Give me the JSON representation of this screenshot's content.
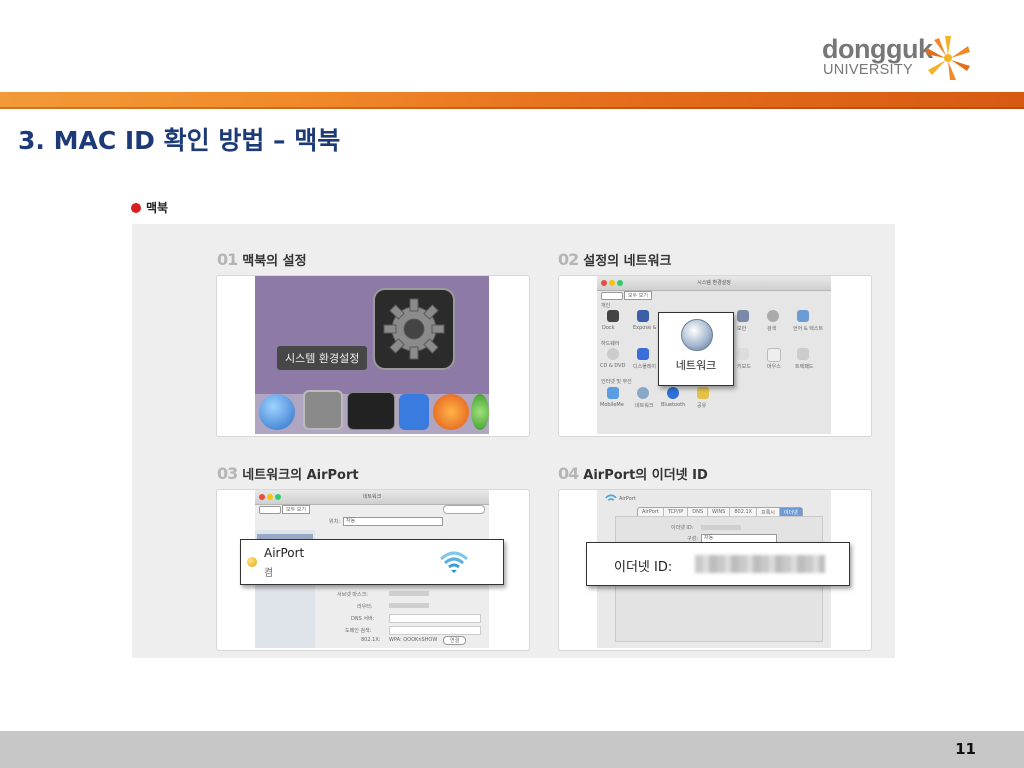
{
  "logo": {
    "line1": "dongguk",
    "line2": "UNIVERSITY"
  },
  "title": "3. MAC ID 확인 방법 – 맥북",
  "section_badge": "맥북",
  "steps": [
    {
      "num": "01",
      "label": "맥북의 설정"
    },
    {
      "num": "02",
      "label": "설정의 네트워크"
    },
    {
      "num": "03",
      "label": "네트워크의 AirPort"
    },
    {
      "num": "04",
      "label": "AirPort의 이더넷 ID"
    }
  ],
  "shot1": {
    "callout": "시스템 환경설정"
  },
  "shot2": {
    "window_title": "시스템 환경설정",
    "show_all": "모두 보기",
    "row1_label": "개인",
    "row2_label": "하드웨어",
    "row3_label": "인터넷 및 무선",
    "icons_row1": [
      "Dock",
      "Exposé & Spaces",
      "보안",
      "검색",
      "언어 & 텍스트"
    ],
    "icons_row2": [
      "CD & DVD",
      "디스플레이",
      "키보드",
      "마우스",
      "트랙패드"
    ],
    "icons_row3": [
      "MobileMe",
      "네트워크",
      "Bluetooth",
      "공유"
    ],
    "popup": "네트워크"
  },
  "shot3": {
    "window_title": "네트워크",
    "show_all": "모두 보기",
    "location_label": "위치:",
    "location_value": "자동",
    "rows": [
      "서브넷 마스크:",
      "라우터:",
      "DNS 서버:",
      "도메인 검색:",
      "802.1X:"
    ],
    "row_802_value": "WPA: QOOKnSHOW",
    "connect_btn": "연결",
    "popup_title": "AirPort",
    "popup_status": "켬"
  },
  "shot4": {
    "header": "AirPort",
    "tabs": [
      "AirPort",
      "TCP/IP",
      "DNS",
      "WINS",
      "802.1X",
      "프록시",
      "이더넷"
    ],
    "field1": "이더넷 ID:",
    "field2": "구성:",
    "field2_value": "자동",
    "popup_label": "이더넷 ID:"
  },
  "page_number": "11",
  "colors": {
    "band": "#e46e1c",
    "title": "#1d3a78",
    "footer": "#c7c7c7",
    "badge_dot": "#d81e1e"
  }
}
